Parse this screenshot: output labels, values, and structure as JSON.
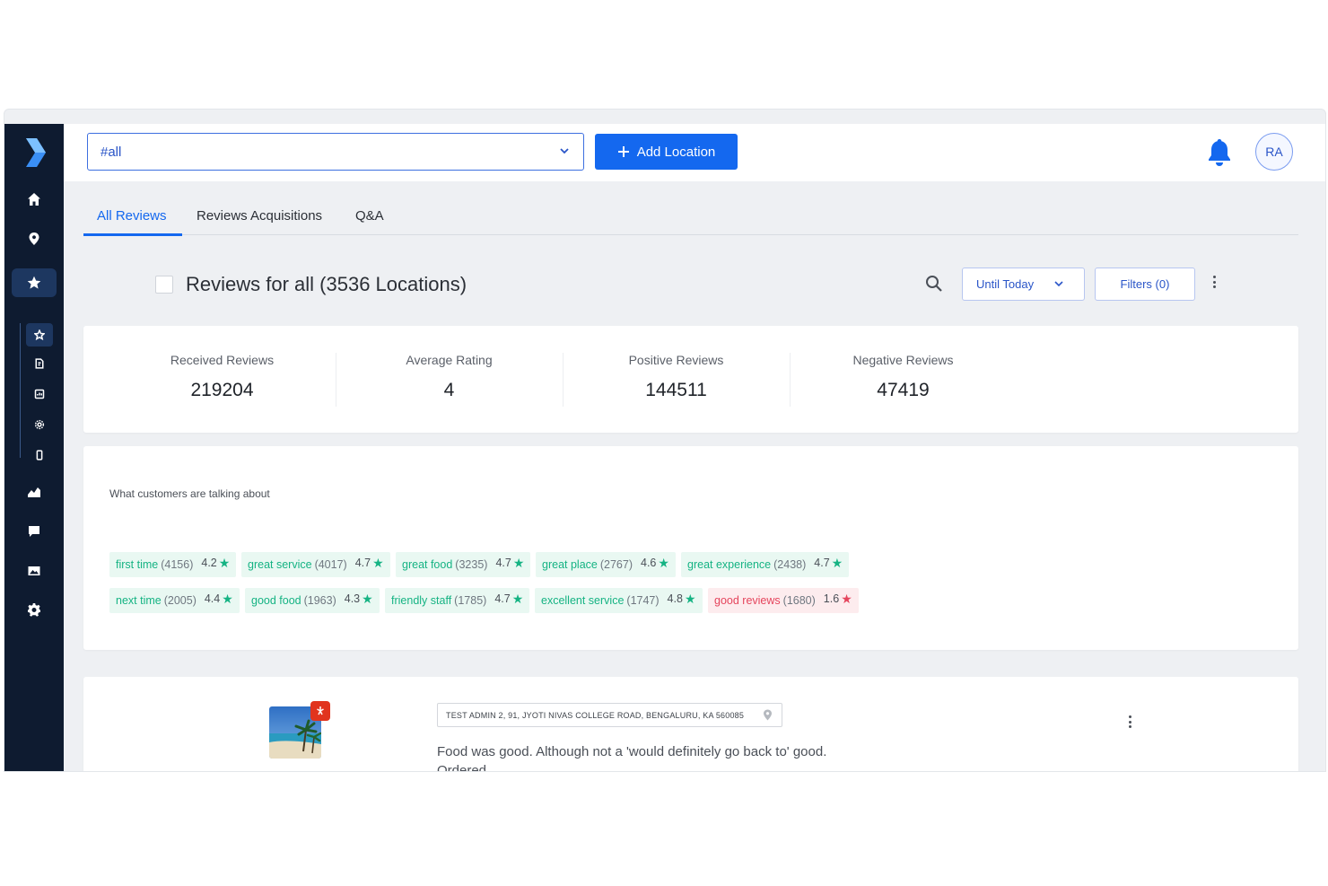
{
  "topbar": {
    "location_select_value": "#all",
    "add_location_label": "Add Location",
    "avatar_initials": "RA"
  },
  "tabs": [
    {
      "label": "All Reviews",
      "active": true
    },
    {
      "label": "Reviews Acquisitions",
      "active": false
    },
    {
      "label": "Q&A",
      "active": false
    }
  ],
  "header": {
    "title": "Reviews for all (3536 Locations)",
    "date_filter_label": "Until Today",
    "filters_label": "Filters (0)"
  },
  "stats": [
    {
      "label": "Received Reviews",
      "value": "219204"
    },
    {
      "label": "Average Rating",
      "value": "4"
    },
    {
      "label": "Positive Reviews",
      "value": "144511"
    },
    {
      "label": "Negative Reviews",
      "value": "47419"
    }
  ],
  "topics": {
    "heading": "What customers are talking about",
    "rows": [
      [
        {
          "term": "first time",
          "count": "(4156)",
          "rating": "4.2",
          "sentiment": "positive"
        },
        {
          "term": "great service",
          "count": "(4017)",
          "rating": "4.7",
          "sentiment": "positive"
        },
        {
          "term": "great food",
          "count": "(3235)",
          "rating": "4.7",
          "sentiment": "positive"
        },
        {
          "term": "great place",
          "count": "(2767)",
          "rating": "4.6",
          "sentiment": "positive"
        },
        {
          "term": "great experience",
          "count": "(2438)",
          "rating": "4.7",
          "sentiment": "positive"
        }
      ],
      [
        {
          "term": "next time",
          "count": "(2005)",
          "rating": "4.4",
          "sentiment": "positive"
        },
        {
          "term": "good food",
          "count": "(1963)",
          "rating": "4.3",
          "sentiment": "positive"
        },
        {
          "term": "friendly staff",
          "count": "(1785)",
          "rating": "4.7",
          "sentiment": "positive"
        },
        {
          "term": "excellent service",
          "count": "(1747)",
          "rating": "4.8",
          "sentiment": "positive"
        },
        {
          "term": "good reviews",
          "count": "(1680)",
          "rating": "1.6",
          "sentiment": "negative"
        }
      ]
    ]
  },
  "review": {
    "address": "TEST ADMIN 2, 91, JYOTI NIVAS COLLEGE ROAD, BENGALURU, KA 560085",
    "text_line1": "Food was good. Although not a 'would definitely go back to' good.",
    "text_line2": "Ordered"
  },
  "colors": {
    "sidebar": "#0e1b30",
    "accent": "#1468ef",
    "positive": "#15b383",
    "negative": "#e5455d"
  },
  "icons": {
    "sidebar": [
      "logo-chevron-icon",
      "home-icon",
      "location-pin-icon",
      "star-icon",
      "star-outline-icon",
      "document-edit-icon",
      "calendar-icon",
      "gear-outline-icon",
      "mobile-icon",
      "analytics-icon",
      "chat-icon",
      "image-icon",
      "settings-icon"
    ],
    "topbar": [
      "chevron-down-icon",
      "plus-icon",
      "bell-icon"
    ]
  }
}
